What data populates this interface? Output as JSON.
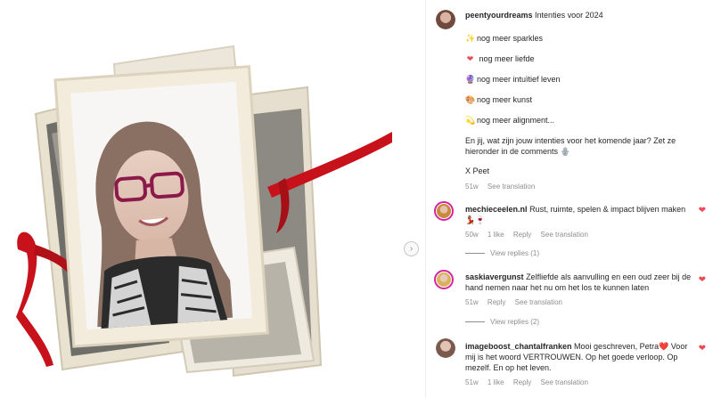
{
  "post": {
    "username": "peentyourdreams",
    "title": "Intenties voor 2024",
    "caption_lines": [
      {
        "emoji": "✨",
        "text": "nog meer sparkles"
      },
      {
        "emoji": "❤",
        "text": " nog meer liefde"
      },
      {
        "emoji": "🔮",
        "text": "nog meer intuïtief leven"
      },
      {
        "emoji": "🎨",
        "text": "nog meer kunst"
      },
      {
        "emoji": "💫",
        "text": "nog meer alignment..."
      }
    ],
    "question": "En jij, wat zijn jouw intenties voor het komende jaar? Zet ze hieronder in de comments 🪬",
    "signoff": "X Peet",
    "time": "51w",
    "see_translation": "See translation"
  },
  "comments": [
    {
      "username": "mechieceelen.nl",
      "text": "Rust, ruimte, spelen & impact blijven maken 💃🏽🍷",
      "time": "50w",
      "likes": "1 like",
      "reply": "Reply",
      "see_translation": "See translation",
      "view_replies": "View replies (1)"
    },
    {
      "username": "saskiavergunst",
      "text": "Zelfliefde als aanvulling en een oud zeer bij de hand nemen naar het nu om het los te kunnen laten",
      "time": "51w",
      "likes": "",
      "reply": "Reply",
      "see_translation": "See translation",
      "view_replies": "View replies (2)"
    },
    {
      "username": "imageboost_chantalfranken",
      "text": "Mooi geschreven, Petra❤️ Voor mij is het woord VERTROUWEN. Op het goede verloop. Op mezelf. En op het leven.",
      "time": "51w",
      "likes": "1 like",
      "reply": "Reply",
      "see_translation": "See translation",
      "view_replies": ""
    }
  ],
  "icons": {
    "next": "›",
    "heart": "❤"
  },
  "colors": {
    "heart": "#ed4956",
    "ribbon": "#c8121b",
    "meta_text": "#8e8e8e"
  }
}
